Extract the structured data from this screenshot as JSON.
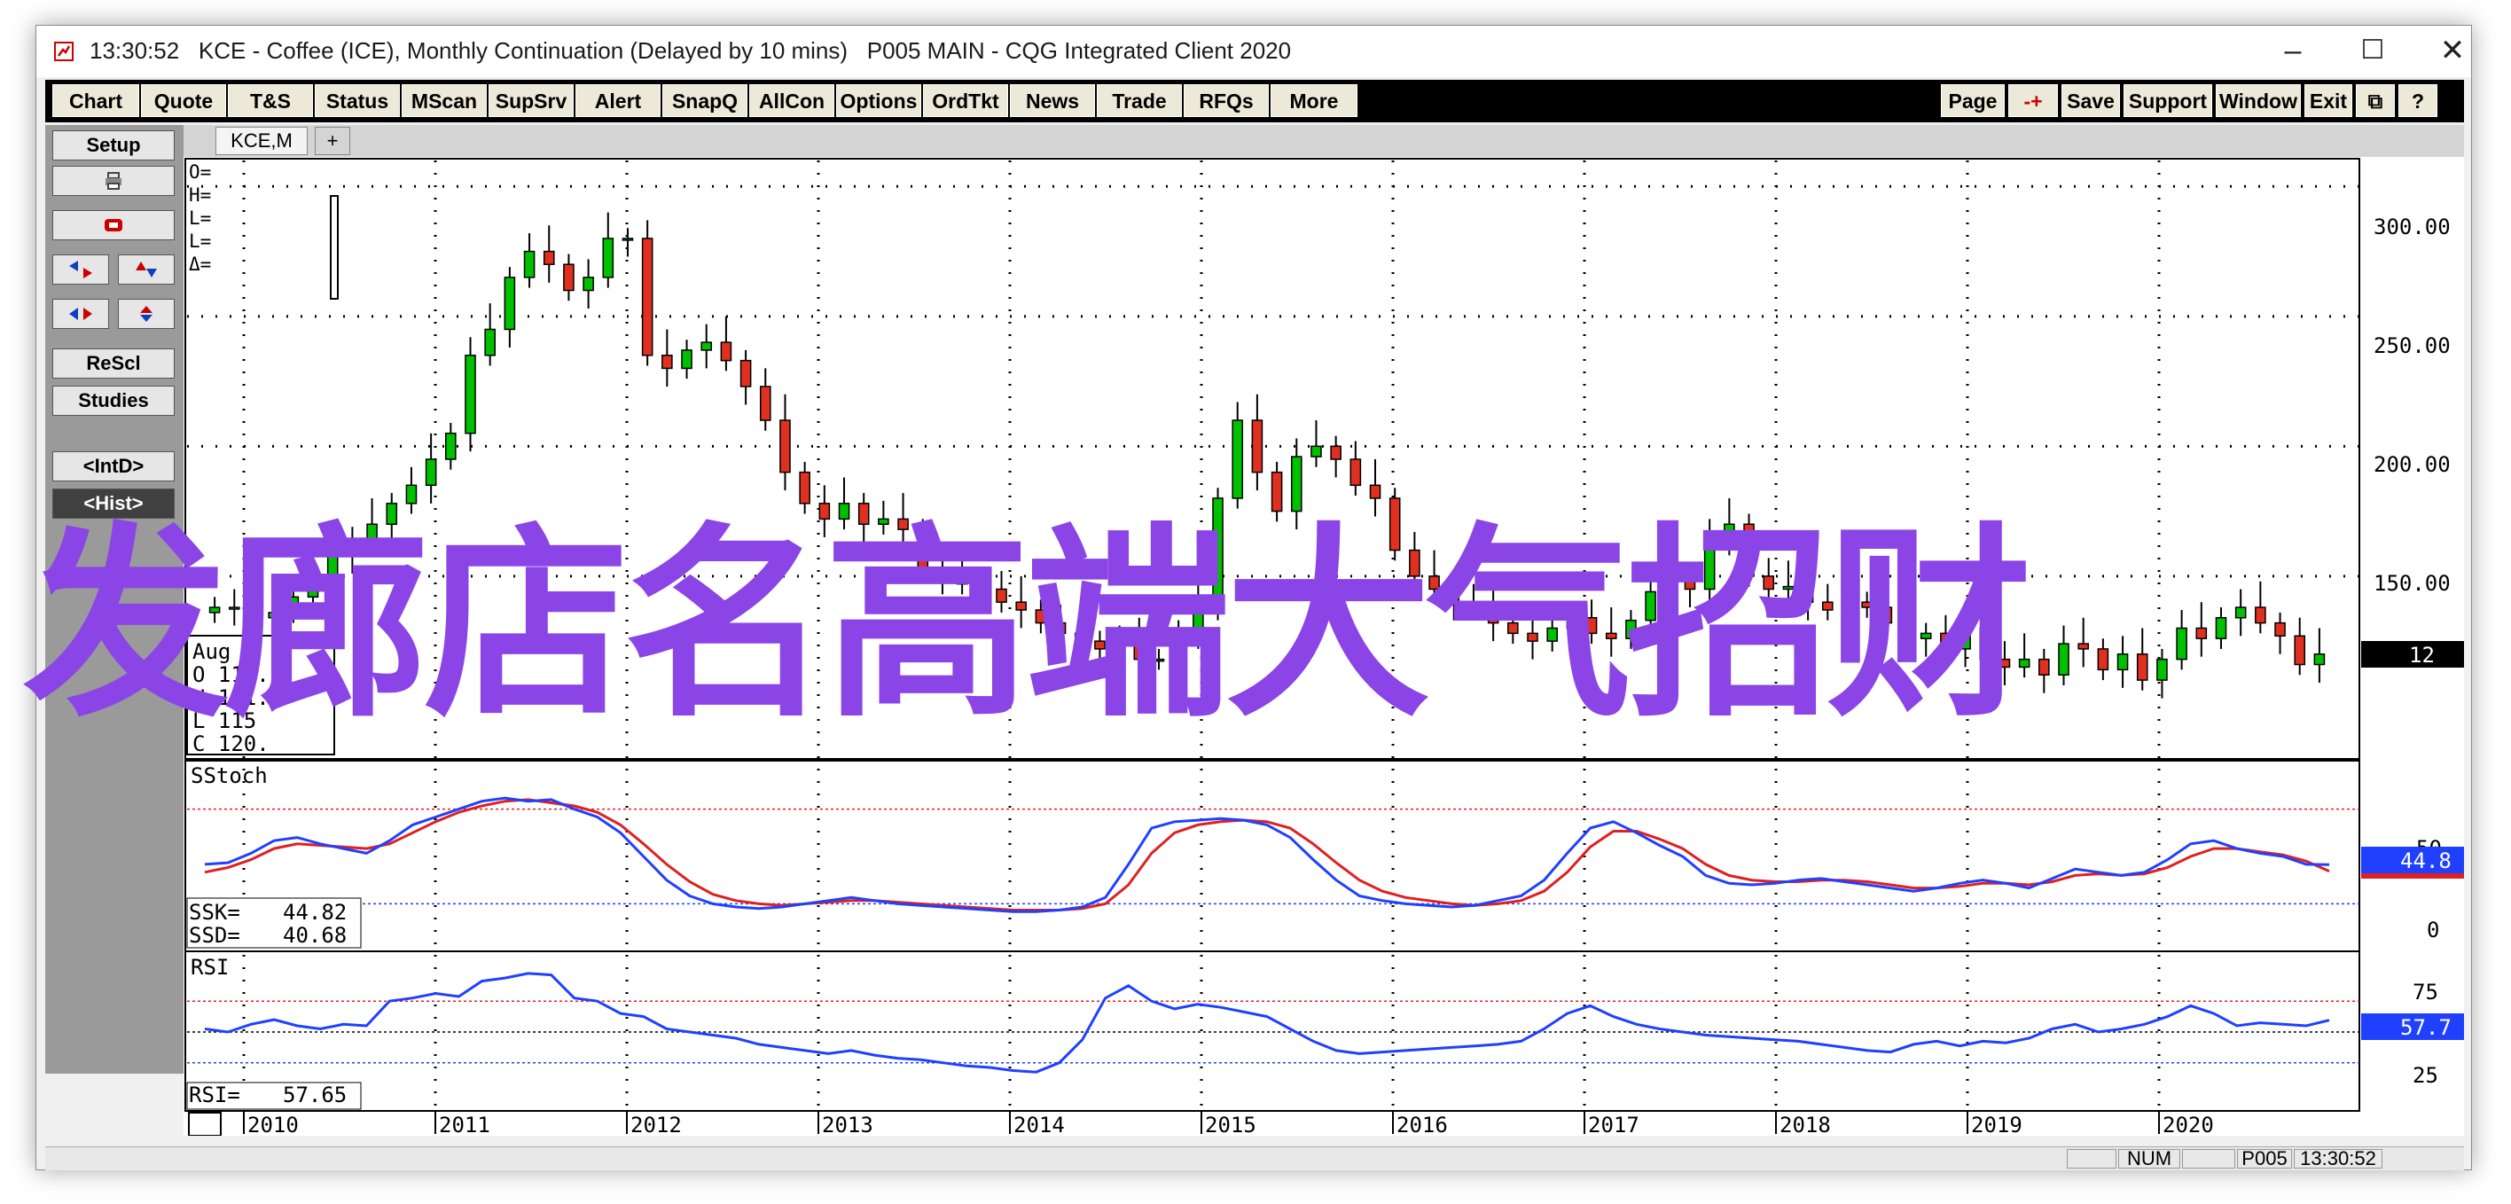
{
  "window": {
    "time": "13:30:52",
    "title": "KCE - Coffee (ICE), Monthly Continuation (Delayed by 10 mins)",
    "page_main": "P005 MAIN - CQG Integrated Client 2020",
    "minimize": "–",
    "maximize": "☐",
    "close": "✕"
  },
  "menu": {
    "left": [
      "Chart",
      "Quote",
      "T&S",
      "Status",
      "MScan",
      "SupSrv",
      "Alert",
      "SnapQ",
      "AllCon",
      "Options",
      "OrdTkt",
      "News",
      "Trade",
      "RFQs",
      "More"
    ],
    "right": [
      "Page",
      "-+",
      "Save",
      "Support",
      "Window",
      "Exit",
      "⧉",
      "?"
    ]
  },
  "sidebar": {
    "setup": "Setup",
    "print_icon": "print-icon",
    "rescl": "ReScl",
    "studies": "Studies",
    "intd": "<IntD>",
    "hist": "<Hist>"
  },
  "tabs": {
    "active": "KCE,M",
    "add": "+"
  },
  "ohlc_box": {
    "lines": [
      "O=",
      "H=",
      "L=",
      "L=",
      "Δ="
    ]
  },
  "price_box": {
    "lines": [
      "Aug 2",
      "O   118.",
      "H   121.",
      "L   115",
      "C   120."
    ]
  },
  "price_axis": {
    "ticks": [
      "300.00",
      "250.00",
      "200.00",
      "150.00"
    ],
    "current": "12"
  },
  "stoch": {
    "label": "SStoch",
    "ssk_label": "SSK=",
    "ssk": "44.82",
    "ssd_label": "SSD=",
    "ssd": "40.68",
    "axis": [
      "50",
      "0"
    ],
    "current": "44.8"
  },
  "rsi": {
    "label": "RSI",
    "value_label": "RSI=",
    "value": "57.65",
    "axis": [
      "75",
      "25"
    ],
    "current": "57.7"
  },
  "xaxis": [
    "2010",
    "2011",
    "2012",
    "2013",
    "2014",
    "2015",
    "2016",
    "2017",
    "2018",
    "2019",
    "2020"
  ],
  "status": {
    "num": "NUM",
    "page": "P005",
    "time": "13:30:52"
  },
  "overlay_text": "发廊店名高端大气招财",
  "chart_data": [
    {
      "type": "candlestick",
      "title": "KCE - Coffee (ICE), Monthly Continuation",
      "ylim": [
        80,
        310
      ],
      "y_ticks": [
        150,
        200,
        250,
        300
      ],
      "x_labels": [
        "2010",
        "2011",
        "2012",
        "2013",
        "2014",
        "2015",
        "2016",
        "2017",
        "2018",
        "2019",
        "2020"
      ],
      "series": [
        {
          "name": "KCE,M",
          "closes": [
            138,
            138,
            134,
            136,
            142,
            148,
            158,
            162,
            170,
            178,
            185,
            195,
            205,
            235,
            245,
            265,
            275,
            270,
            260,
            265,
            280,
            280,
            235,
            230,
            237,
            240,
            233,
            223,
            210,
            190,
            178,
            172,
            178,
            170,
            172,
            168,
            152,
            150,
            147,
            145,
            140,
            137,
            132,
            128,
            125,
            122,
            124,
            118,
            118,
            126,
            140,
            180,
            210,
            190,
            175,
            196,
            200,
            195,
            185,
            180,
            160,
            150,
            145,
            140,
            137,
            132,
            128,
            125,
            130,
            134,
            128,
            126,
            133,
            144,
            150,
            145,
            165,
            170,
            150,
            145,
            146,
            140,
            137,
            140,
            138,
            132,
            126,
            128,
            122,
            130,
            118,
            115,
            118,
            112,
            124,
            122,
            114,
            120,
            110,
            118,
            130,
            126,
            134,
            138,
            132,
            127,
            116,
            120
          ],
          "up_color": "#00c000",
          "down_color": "#e03020"
        }
      ]
    },
    {
      "type": "line",
      "title": "SStoch",
      "ylim": [
        0,
        100
      ],
      "y_ticks": [
        0,
        50
      ],
      "series": [
        {
          "name": "SSK",
          "color": "#2040ff",
          "values": [
            45,
            46,
            52,
            60,
            62,
            58,
            55,
            52,
            60,
            70,
            75,
            80,
            85,
            87,
            85,
            86,
            80,
            75,
            65,
            50,
            35,
            25,
            20,
            18,
            17,
            18,
            20,
            22,
            24,
            22,
            20,
            19,
            18,
            17,
            16,
            15,
            15,
            16,
            18,
            24,
            45,
            68,
            72,
            73,
            74,
            73,
            70,
            62,
            48,
            35,
            25,
            22,
            20,
            19,
            18,
            19,
            22,
            25,
            35,
            52,
            68,
            72,
            65,
            57,
            50,
            38,
            33,
            32,
            33,
            35,
            36,
            34,
            32,
            30,
            28,
            30,
            33,
            35,
            33,
            30,
            36,
            42,
            40,
            38,
            40,
            48,
            58,
            60,
            55,
            52,
            50,
            45,
            44.82
          ]
        },
        {
          "name": "SSD",
          "color": "#e02020",
          "values": [
            40,
            43,
            48,
            55,
            58,
            57,
            56,
            55,
            58,
            65,
            72,
            78,
            82,
            85,
            86,
            84,
            82,
            78,
            70,
            58,
            45,
            34,
            26,
            22,
            20,
            19,
            20,
            21,
            22,
            22,
            21,
            20,
            19,
            18,
            17,
            16,
            16,
            16,
            17,
            20,
            32,
            52,
            65,
            70,
            72,
            73,
            72,
            68,
            58,
            46,
            35,
            28,
            24,
            22,
            20,
            19,
            20,
            22,
            28,
            40,
            56,
            66,
            66,
            61,
            55,
            45,
            38,
            35,
            34,
            34,
            35,
            35,
            34,
            32,
            30,
            30,
            31,
            33,
            33,
            32,
            34,
            38,
            39,
            38,
            39,
            43,
            50,
            55,
            55,
            53,
            51,
            47,
            40.68
          ]
        }
      ]
    },
    {
      "type": "line",
      "title": "RSI",
      "ylim": [
        0,
        100
      ],
      "y_ticks": [
        25,
        75
      ],
      "series": [
        {
          "name": "RSI",
          "color": "#2040ff",
          "values": [
            52,
            50,
            55,
            58,
            54,
            52,
            55,
            54,
            70,
            72,
            75,
            73,
            83,
            85,
            88,
            87,
            72,
            70,
            62,
            60,
            52,
            50,
            48,
            46,
            42,
            40,
            38,
            36,
            38,
            35,
            33,
            32,
            30,
            28,
            27,
            25,
            24,
            30,
            45,
            72,
            80,
            70,
            65,
            68,
            66,
            63,
            60,
            52,
            44,
            38,
            36,
            37,
            38,
            39,
            40,
            41,
            42,
            44,
            52,
            62,
            67,
            60,
            55,
            52,
            50,
            48,
            47,
            46,
            45,
            44,
            42,
            40,
            38,
            37,
            42,
            44,
            41,
            44,
            43,
            46,
            52,
            55,
            50,
            52,
            55,
            60,
            67,
            62,
            54,
            56,
            55,
            54,
            57.65
          ]
        }
      ]
    }
  ]
}
